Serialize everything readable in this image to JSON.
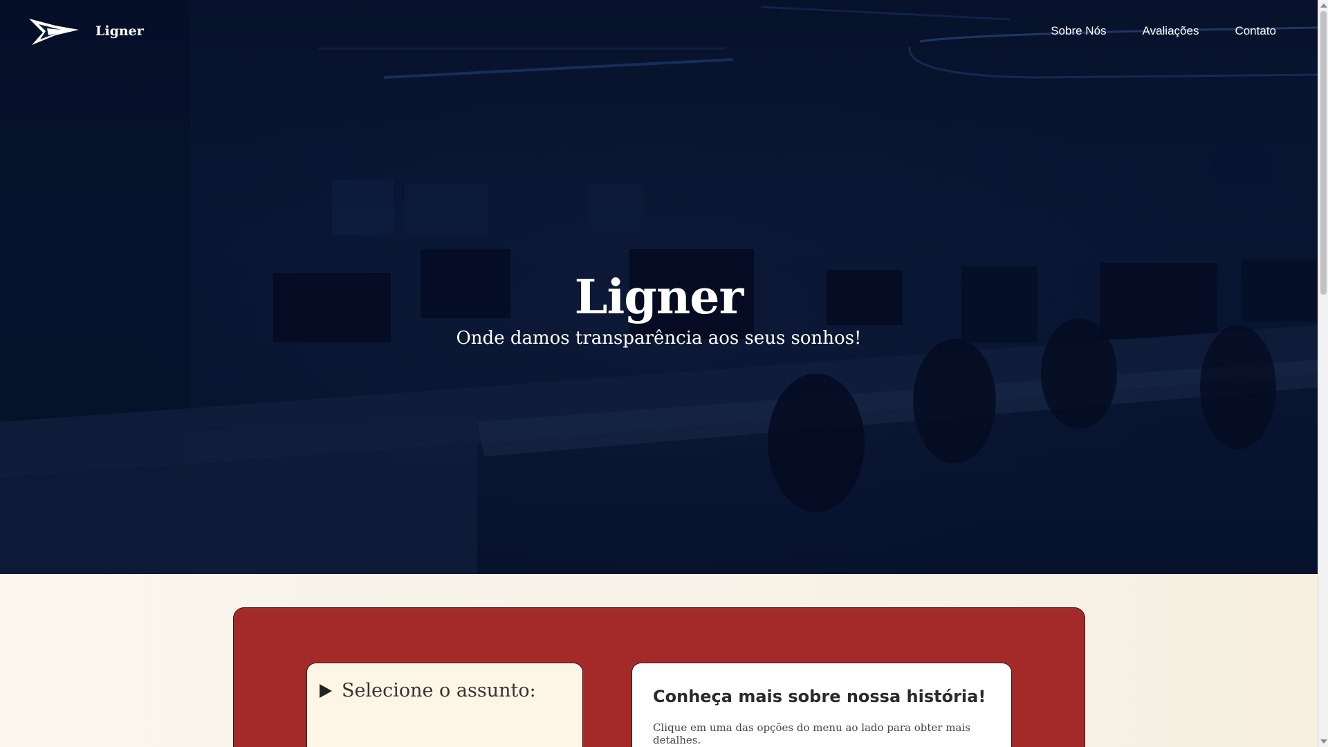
{
  "nav": {
    "brand": "Ligner",
    "links": [
      {
        "label": "Sobre Nós"
      },
      {
        "label": "Avaliações"
      },
      {
        "label": "Contato"
      }
    ]
  },
  "hero": {
    "title": "Ligner",
    "subtitle": "Onde damos transparência aos seus sonhos!"
  },
  "menu": {
    "summary": "Selecione o assunto:"
  },
  "info": {
    "heading": "Conheça mais sobre nossa história!",
    "text": "Clique em uma das opções do menu ao lado para obter mais detalhes."
  },
  "colors": {
    "hero_overlay": "#0b1a38",
    "panel_red": "#a42a2a",
    "page_bg": "#f7f1e6",
    "card_cream": "#fdf6e6"
  },
  "icons": {
    "logo": "arrow-logo-icon",
    "summary_marker": "triangle-right-icon"
  }
}
